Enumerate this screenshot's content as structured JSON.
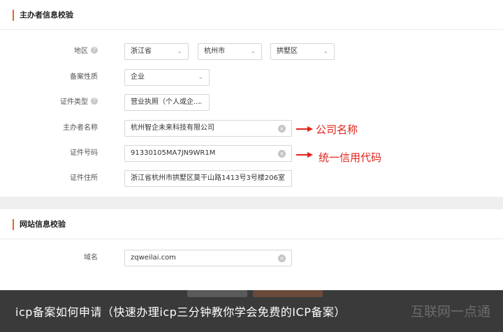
{
  "section1": {
    "title": "主办者信息校验",
    "fields": {
      "region": {
        "label": "地区",
        "province": "浙江省",
        "city": "杭州市",
        "district": "拱墅区"
      },
      "nature": {
        "label": "备案性质",
        "value": "企业"
      },
      "cert_type": {
        "label": "证件类型",
        "value": "营业执照（个人或企..."
      },
      "org_name": {
        "label": "主办者名称",
        "value": "杭州智企未来科技有限公司"
      },
      "cert_no": {
        "label": "证件号码",
        "value": "91330105MA7JN9WR1M"
      },
      "address": {
        "label": "证件住所",
        "value": "浙江省杭州市拱墅区莫干山路1413号3号楼206室"
      }
    },
    "annotations": {
      "company_name": "公司名称",
      "credit_code": "统一信用代码"
    }
  },
  "section2": {
    "title": "网站信息校验",
    "domain": {
      "label": "域名",
      "value": "zqweilai.com"
    }
  },
  "caption": {
    "text": "icp备案如何申请（快速办理icp三分钟教你学会免费的ICP备案）",
    "watermark": "互联网一点通"
  },
  "icons": {
    "help": "help-circle-icon",
    "chevron": "chevron-down-icon",
    "clear": "clear-icon",
    "arrow": "red-arrow-icon"
  },
  "colors": {
    "accent": "#e8661c",
    "annotation": "#e2231a",
    "caption_bg": "#3a3a3a"
  }
}
